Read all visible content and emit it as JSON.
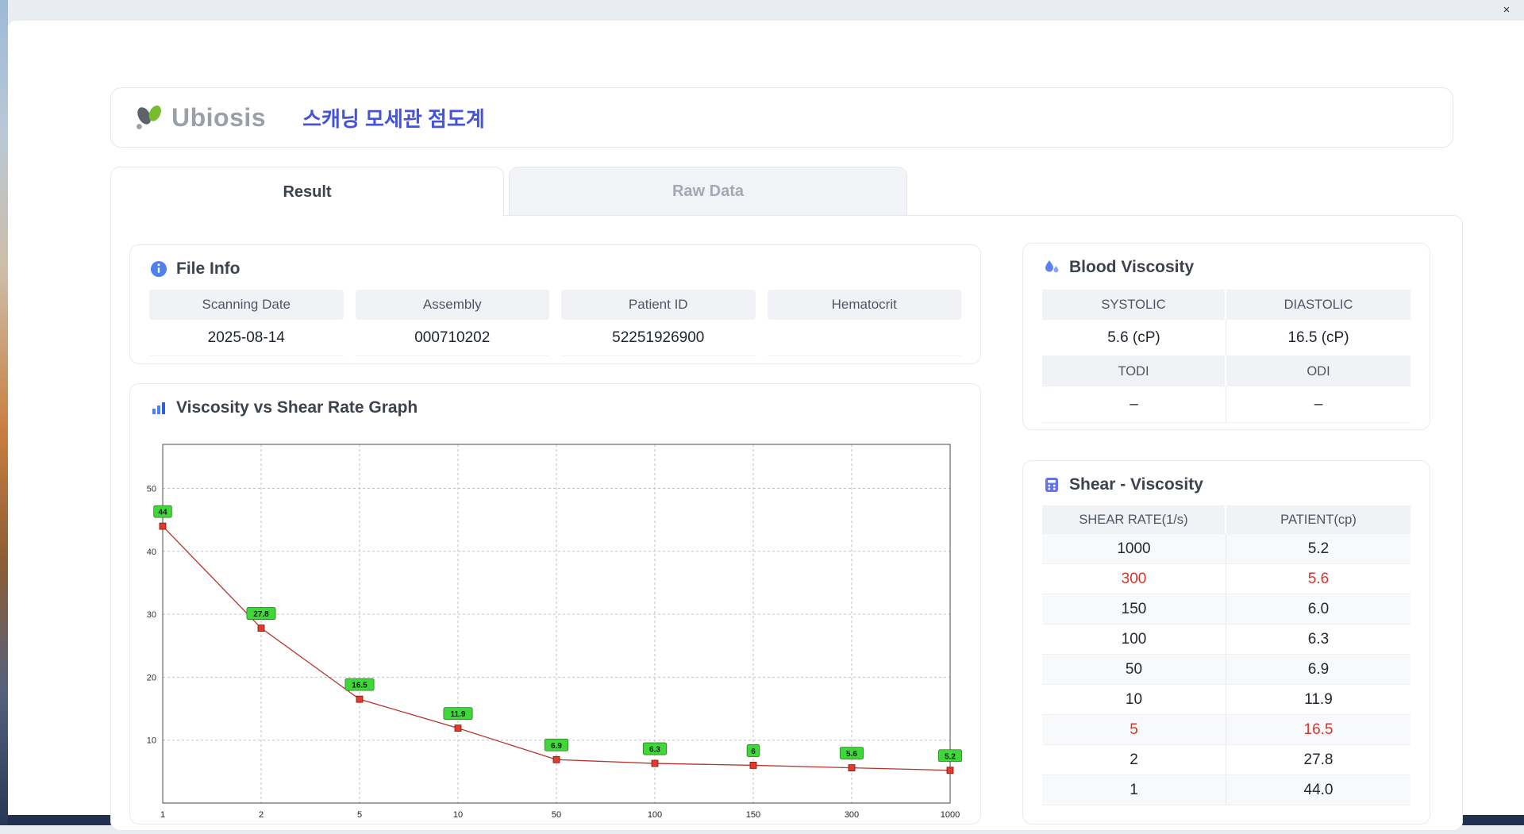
{
  "window": {
    "close_glyph": "×"
  },
  "header": {
    "logo_text": "Ubiosis",
    "title": "스캐닝 모세관 점도계"
  },
  "tabs": [
    {
      "label": "Result",
      "active": true
    },
    {
      "label": "Raw Data",
      "active": false
    }
  ],
  "file_info": {
    "title": "File Info",
    "fields": [
      {
        "label": "Scanning Date",
        "value": "2025-08-14"
      },
      {
        "label": "Assembly",
        "value": "000710202"
      },
      {
        "label": "Patient ID",
        "value": "52251926900"
      },
      {
        "label": "Hematocrit",
        "value": ""
      }
    ]
  },
  "blood_viscosity": {
    "title": "Blood Viscosity",
    "cells": [
      {
        "label": "SYSTOLIC",
        "value": "5.6 (cP)"
      },
      {
        "label": "DIASTOLIC",
        "value": "16.5 (cP)"
      },
      {
        "label": "TODI",
        "value": "–"
      },
      {
        "label": "ODI",
        "value": "–"
      }
    ]
  },
  "shear_table": {
    "title": "Shear - Viscosity",
    "columns": [
      "SHEAR RATE(1/s)",
      "PATIENT(cp)"
    ],
    "rows": [
      {
        "rate": "1000",
        "value": "5.2",
        "highlight": false
      },
      {
        "rate": "300",
        "value": "5.6",
        "highlight": true
      },
      {
        "rate": "150",
        "value": "6.0",
        "highlight": false
      },
      {
        "rate": "100",
        "value": "6.3",
        "highlight": false
      },
      {
        "rate": "50",
        "value": "6.9",
        "highlight": false
      },
      {
        "rate": "10",
        "value": "11.9",
        "highlight": false
      },
      {
        "rate": "5",
        "value": "16.5",
        "highlight": true
      },
      {
        "rate": "2",
        "value": "27.8",
        "highlight": false
      },
      {
        "rate": "1",
        "value": "44.0",
        "highlight": false
      }
    ]
  },
  "chart_data": {
    "type": "line",
    "title": "Viscosity vs Shear Rate Graph",
    "xlabel": "",
    "ylabel": "",
    "categories": [
      "1",
      "2",
      "5",
      "10",
      "50",
      "100",
      "150",
      "300",
      "1000"
    ],
    "values": [
      44,
      27.8,
      16.5,
      11.9,
      6.9,
      6.3,
      6.0,
      5.6,
      5.2
    ],
    "point_labels": [
      "44",
      "27.8",
      "16.5",
      "11.9",
      "6.9",
      "6.3",
      "6",
      "5.6",
      "5.2"
    ],
    "y_ticks": [
      10,
      20,
      30,
      40,
      50
    ],
    "ylim": [
      0,
      57
    ],
    "grid": true,
    "legend": "none",
    "line_color": "#b5342c",
    "marker_color": "#e23a2c",
    "label_bg": "#3fd73a"
  }
}
